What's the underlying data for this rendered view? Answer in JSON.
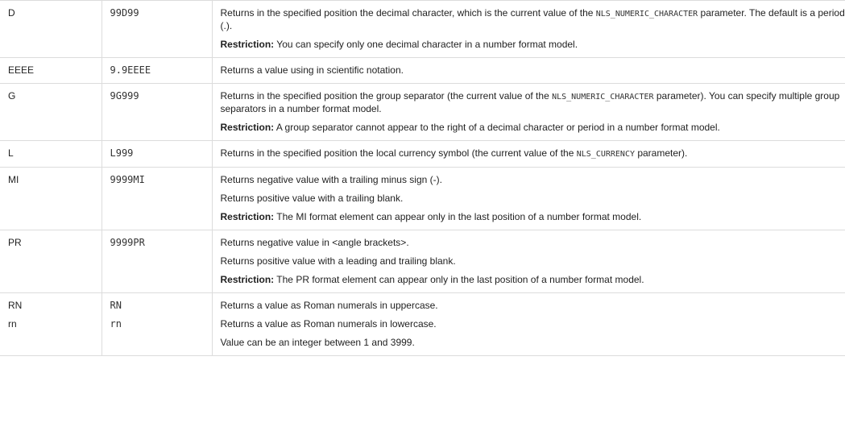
{
  "rows": [
    {
      "element": "D",
      "example": "99D99",
      "desc": [
        {
          "a": "Returns in the specified position the decimal character, which is the current value of the ",
          "code": "NLS_NUMERIC_CHARACTER",
          "b": " parameter. The default is a period (.)."
        },
        {
          "bold": "Restriction:",
          "text": " You can specify only one decimal character in a number format model."
        }
      ]
    },
    {
      "element": "EEEE",
      "example": "9.9EEEE",
      "desc": [
        {
          "text": "Returns a value using in scientific notation."
        }
      ]
    },
    {
      "element": "G",
      "example": "9G999",
      "desc": [
        {
          "a": "Returns in the specified position the group separator (the current value of the ",
          "code": "NLS_NUMERIC_CHARACTER",
          "b": " parameter). You can specify multiple group separators in a number format model."
        },
        {
          "bold": "Restriction:",
          "text": " A group separator cannot appear to the right of a decimal character or period in a number format model."
        }
      ]
    },
    {
      "element": "L",
      "example": "L999",
      "desc": [
        {
          "a": "Returns in the specified position the local currency symbol (the current value of the ",
          "code": "NLS_CURRENCY",
          "b": " parameter)."
        }
      ]
    },
    {
      "element": "MI",
      "example": "9999MI",
      "desc": [
        {
          "text": "Returns negative value with a trailing minus sign (-)."
        },
        {
          "text": "Returns positive value with a trailing blank."
        },
        {
          "bold": "Restriction:",
          "text": " The MI format element can appear only in the last position of a number format model."
        }
      ]
    },
    {
      "element": "PR",
      "example": "9999PR",
      "desc": [
        {
          "text": "Returns negative value in <angle brackets>."
        },
        {
          "text": "Returns positive value with a leading and trailing blank."
        },
        {
          "bold": "Restriction:",
          "text": " The PR format element can appear only in the last position of a number format model."
        }
      ]
    },
    {
      "elements": [
        "RN",
        "rn"
      ],
      "examples": [
        "RN",
        "rn"
      ],
      "desc": [
        {
          "text": "Returns a value as Roman numerals in uppercase."
        },
        {
          "text": "Returns a value as Roman numerals in lowercase."
        },
        {
          "text": "Value can be an integer between 1 and 3999."
        }
      ]
    }
  ]
}
